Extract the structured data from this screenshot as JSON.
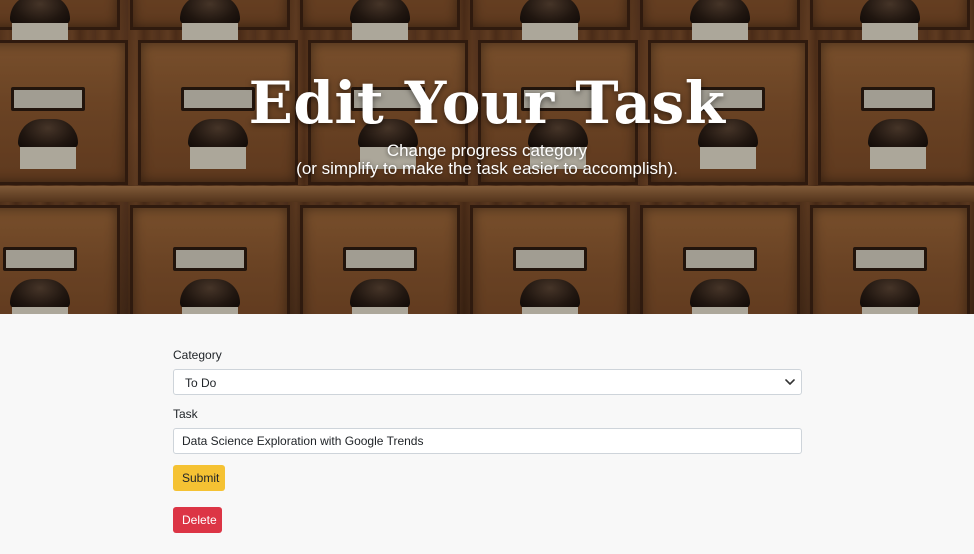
{
  "hero": {
    "title": "Edit Your Task",
    "subtitle_line1": "Change progress category",
    "subtitle_line2": "(or simplify to make the task easier to accomplish)."
  },
  "form": {
    "category": {
      "label": "Category",
      "selected": "To Do"
    },
    "task": {
      "label": "Task",
      "value": "Data Science Exploration with Google Trends"
    },
    "submit_label": "Submit",
    "delete_label": "Delete"
  },
  "colors": {
    "submit": "#f5c233",
    "delete": "#dc3545",
    "page_background": "#f8f8f8"
  },
  "icons": {
    "select": "chevron-down-icon"
  }
}
